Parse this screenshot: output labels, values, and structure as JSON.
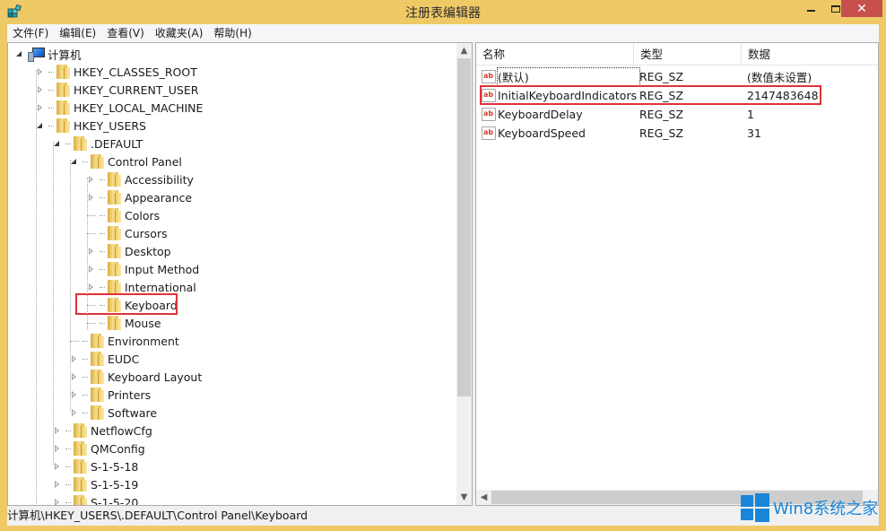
{
  "window": {
    "title": "注册表编辑器",
    "app_icon": "registry-editor-icon",
    "controls": {
      "minimize": "minimize-icon",
      "maximize": "maximize-icon",
      "close_glyph": "✕"
    }
  },
  "menu": [
    {
      "label": "文件(F)"
    },
    {
      "label": "编辑(E)"
    },
    {
      "label": "查看(V)"
    },
    {
      "label": "收藏夹(A)"
    },
    {
      "label": "帮助(H)"
    }
  ],
  "tree": {
    "root": {
      "label": "计算机",
      "icon": "computer-icon",
      "expanded": true
    },
    "nodes": [
      {
        "label": "HKEY_CLASSES_ROOT",
        "level": 1,
        "state": "collapsed"
      },
      {
        "label": "HKEY_CURRENT_USER",
        "level": 1,
        "state": "collapsed"
      },
      {
        "label": "HKEY_LOCAL_MACHINE",
        "level": 1,
        "state": "collapsed"
      },
      {
        "label": "HKEY_USERS",
        "level": 1,
        "state": "expanded"
      },
      {
        "label": ".DEFAULT",
        "level": 2,
        "state": "expanded"
      },
      {
        "label": "Control Panel",
        "level": 3,
        "state": "expanded"
      },
      {
        "label": "Accessibility",
        "level": 4,
        "state": "collapsed"
      },
      {
        "label": "Appearance",
        "level": 4,
        "state": "collapsed"
      },
      {
        "label": "Colors",
        "level": 4,
        "state": "none"
      },
      {
        "label": "Cursors",
        "level": 4,
        "state": "none"
      },
      {
        "label": "Desktop",
        "level": 4,
        "state": "collapsed"
      },
      {
        "label": "Input Method",
        "level": 4,
        "state": "collapsed"
      },
      {
        "label": "International",
        "level": 4,
        "state": "collapsed"
      },
      {
        "label": "Keyboard",
        "level": 4,
        "state": "none",
        "selected": true
      },
      {
        "label": "Mouse",
        "level": 4,
        "state": "none"
      },
      {
        "label": "Environment",
        "level": 3,
        "state": "none"
      },
      {
        "label": "EUDC",
        "level": 3,
        "state": "collapsed"
      },
      {
        "label": "Keyboard Layout",
        "level": 3,
        "state": "collapsed"
      },
      {
        "label": "Printers",
        "level": 3,
        "state": "collapsed"
      },
      {
        "label": "Software",
        "level": 3,
        "state": "collapsed"
      },
      {
        "label": "NetflowCfg",
        "level": 2,
        "state": "collapsed"
      },
      {
        "label": "QMConfig",
        "level": 2,
        "state": "collapsed"
      },
      {
        "label": "S-1-5-18",
        "level": 2,
        "state": "collapsed"
      },
      {
        "label": "S-1-5-19",
        "level": 2,
        "state": "collapsed"
      },
      {
        "label": "S-1-5-20",
        "level": 2,
        "state": "collapsed"
      }
    ]
  },
  "values_list": {
    "columns": [
      "名称",
      "类型",
      "数据"
    ],
    "rows": [
      {
        "name": "(默认)",
        "type": "REG_SZ",
        "data": "(数值未设置)",
        "icon": "string-value-icon",
        "focused": true
      },
      {
        "name": "InitialKeyboardIndicators",
        "type": "REG_SZ",
        "data": "2147483648",
        "icon": "string-value-icon",
        "highlighted": true
      },
      {
        "name": "KeyboardDelay",
        "type": "REG_SZ",
        "data": "1",
        "icon": "string-value-icon"
      },
      {
        "name": "KeyboardSpeed",
        "type": "REG_SZ",
        "data": "31",
        "icon": "string-value-icon"
      }
    ],
    "icon_text": "ab"
  },
  "status_bar": {
    "path": "计算机\\HKEY_USERS\\.DEFAULT\\Control Panel\\Keyboard"
  },
  "watermark": {
    "text": "Win8系统之家"
  },
  "colors": {
    "title_bar": "#efc966",
    "close_button": "#c7504c",
    "highlight_box": "#e0313b",
    "watermark": "#1a86d9"
  }
}
